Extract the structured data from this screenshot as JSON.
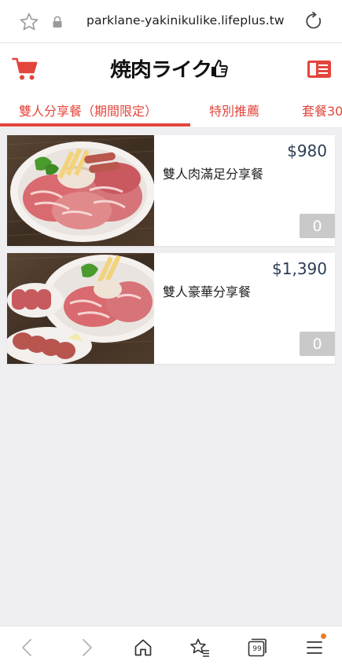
{
  "browser": {
    "url": "parklane-yakinikulike.lifeplus.tw",
    "tab_count": "99"
  },
  "header": {
    "logo_text": "焼肉ライク",
    "accent_color": "#e2453c"
  },
  "tabs": [
    {
      "label": "雙人分享餐（期間限定）",
      "active": true
    },
    {
      "label": "特別推薦",
      "active": false
    },
    {
      "label": "套餐30",
      "active": false
    }
  ],
  "products": [
    {
      "name": "雙人肉滿足分享餐",
      "price": "$980",
      "quantity": "0"
    },
    {
      "name": "雙人豪華分享餐",
      "price": "$1,390",
      "quantity": "0"
    }
  ],
  "icons": {
    "address_bar": [
      "star-icon",
      "lock-icon",
      "reload-icon"
    ],
    "header": [
      "cart-icon",
      "menu-book-icon"
    ],
    "bottom_bar": [
      "back-icon",
      "forward-icon",
      "home-icon",
      "bookmarks-icon",
      "tabs-icon",
      "menu-icon"
    ]
  }
}
